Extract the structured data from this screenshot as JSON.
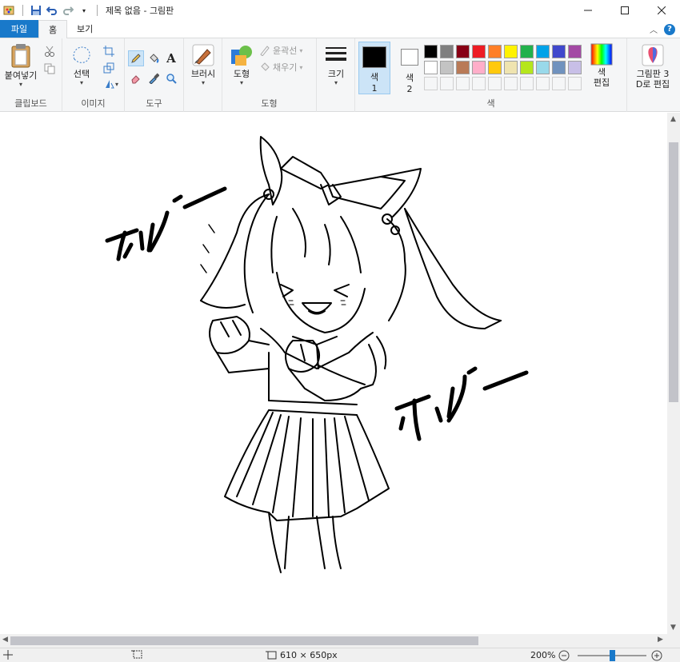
{
  "window": {
    "title": "제목 없음 - 그림판"
  },
  "tabs": {
    "file": "파일",
    "home": "홈",
    "view": "보기"
  },
  "ribbon": {
    "clipboard": {
      "paste_label": "붙여넣기",
      "group_label": "클립보드"
    },
    "image": {
      "select_label": "선택",
      "group_label": "이미지"
    },
    "tools": {
      "group_label": "도구"
    },
    "brushes": {
      "label": "브러시"
    },
    "shapes": {
      "shape_label": "도형",
      "outline_label": "윤곽선",
      "fill_label": "채우기",
      "group_label": "도형"
    },
    "size": {
      "label": "크기"
    },
    "colors": {
      "color1_label": "색",
      "color1_num": "1",
      "color2_label": "색",
      "color2_num": "2",
      "edit_label_1": "색",
      "edit_label_2": "편집",
      "group_label": "색",
      "color1_value": "#000000",
      "color2_value": "#ffffff",
      "palette_row1": [
        "#000000",
        "#7f7f7f",
        "#880015",
        "#ed1c24",
        "#ff7f27",
        "#fff200",
        "#22b14c",
        "#00a2e8",
        "#3f48cc",
        "#a349a4"
      ],
      "palette_row2": [
        "#ffffff",
        "#c3c3c3",
        "#b97a57",
        "#ffaec9",
        "#ffc90e",
        "#efe4b0",
        "#b5e61d",
        "#99d9ea",
        "#7092be",
        "#c8bfe7"
      ]
    },
    "paint3d": {
      "label_1": "그림판 3",
      "label_2": "D로 편집"
    }
  },
  "canvas": {
    "scribble_text_1": "ギャー",
    "scribble_text_2": "ギャー"
  },
  "statusbar": {
    "image_size": "610 × 650px",
    "zoom": "200%",
    "zoom_level": 0.5
  }
}
